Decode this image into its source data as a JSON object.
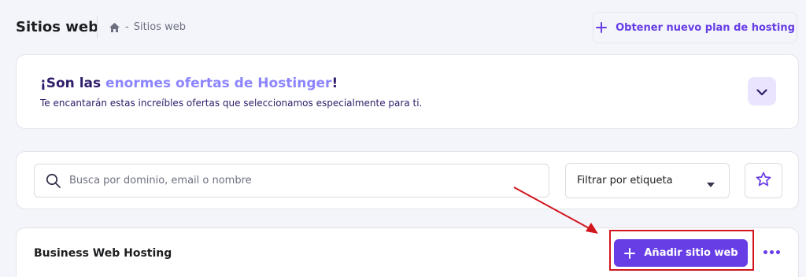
{
  "header": {
    "title": "Sitios web",
    "breadcrumb": {
      "home_icon": "home-icon",
      "separator": "-",
      "current": "Sitios web"
    },
    "new_plan_button": {
      "icon": "plus-icon",
      "label": "Obtener nuevo plan de hosting"
    }
  },
  "promo": {
    "title_prefix": "¡Son las ",
    "title_accent": "enormes ofertas de Hostinger",
    "title_suffix": "!",
    "subtitle": "Te encantarán estas increíbles ofertas que seleccionamos especialmente para ti.",
    "toggle_icon": "chevron-down-icon"
  },
  "search": {
    "icon": "search-icon",
    "placeholder": "Busca por dominio, email o nombre",
    "filter": {
      "selected": "Filtrar por etiqueta",
      "icon": "caret-down-icon"
    },
    "favorites_icon": "star-icon"
  },
  "hosting": {
    "title": "Business Web Hosting",
    "add_site_button": {
      "icon": "plus-icon",
      "label": "Añadir sitio web"
    },
    "more_icon": "more-horizontal-icon"
  },
  "colors": {
    "brand": "#673de6",
    "accent_text": "#8c85ff",
    "annotation_red": "#d2161e",
    "background": "#f4f5fb"
  }
}
